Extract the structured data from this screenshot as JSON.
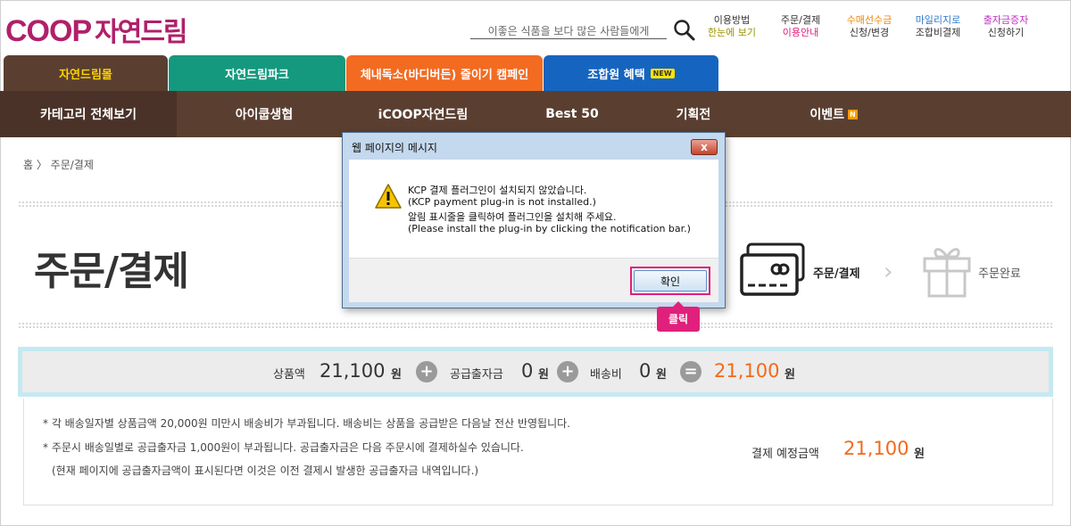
{
  "header": {
    "logo_latin": "COOP",
    "logo_korean": "자연드림",
    "search_placeholder": "이좋은 식품을 보다 많은 사람들에게",
    "top_links": [
      {
        "line1": "이용방법",
        "line2": "한눈에 보기",
        "color1": "#333333",
        "color2": "#9a9400"
      },
      {
        "line1": "주문/결제",
        "line2": "이용안내",
        "color1": "#333333",
        "color2": "#e0207b"
      },
      {
        "line1": "수매선수금",
        "line2": "신청/변경",
        "color1": "#f08300",
        "color2": "#333333"
      },
      {
        "line1": "마일리지로",
        "line2": "조합비결제",
        "color1": "#2f77c8",
        "color2": "#333333"
      },
      {
        "line1": "출자금증자",
        "line2": "신청하기",
        "color1": "#c030c0",
        "color2": "#333333"
      }
    ]
  },
  "tabs": [
    {
      "label": "자연드림몰",
      "color": "#5a3f31",
      "text_color": "#ffd400"
    },
    {
      "label": "자연드림파크",
      "color": "#14997f",
      "text_color": "#ffffff"
    },
    {
      "label": "체내독소(바디버든) 줄이기 캠페인",
      "color": "#f36b21",
      "text_color": "#ffffff"
    },
    {
      "label": "조합원 혜택",
      "color": "#1565c0",
      "text_color": "#ffffff",
      "badge": "NEW"
    }
  ],
  "nav": {
    "items": [
      {
        "label": "카테고리 전체보기"
      },
      {
        "label": "아이쿱생협"
      },
      {
        "label": "iCOOP자연드림"
      },
      {
        "label": "Best 50"
      },
      {
        "label": "기획전"
      },
      {
        "label": "이벤트",
        "badge": "N"
      }
    ]
  },
  "breadcrumb": "홈 〉 주문/결제",
  "page_title": "주문/결제",
  "steps": {
    "current": "주문/결제",
    "next": "주문완료"
  },
  "summary": {
    "product_label": "상품액",
    "product_value": "21,100",
    "supply_label": "공급출자금",
    "supply_value": "0",
    "shipping_label": "배송비",
    "shipping_value": "0",
    "total_value": "21,100",
    "unit": "원",
    "plus": "+",
    "equals": "="
  },
  "notes": [
    "* 각 배송일자별 상품금액 20,000원 미만시 배송비가 부과됩니다. 배송비는 상품을 공급받은 다음날 전산 반영됩니다.",
    "* 주문시 배송일별로 공급출자금 1,000원이 부과됩니다. 공급출자금은 다음 주문시에 결제하실수 있습니다.",
    "(현재 페이지에 공급출자금액이 표시된다면 이것은 이전 결제시 발생한 공급출자금 내역입니다.)"
  ],
  "payment": {
    "label": "결제 예정금액",
    "value": "21,100",
    "unit": "원"
  },
  "dialog": {
    "title": "웹 페이지의 메시지",
    "close": "x",
    "lines": [
      "KCP 결제 플러그인이 설치되지 않았습니다.",
      "(KCP payment plug-in is not installed.)",
      "알림 표시줄을 클릭하여 플러그인을 설치해 주세요.",
      "(Please install the plug-in by clicking the notification bar.)"
    ],
    "ok_label": "확인"
  },
  "annotation": {
    "click_label": "클릭",
    "color": "#e0207b"
  }
}
